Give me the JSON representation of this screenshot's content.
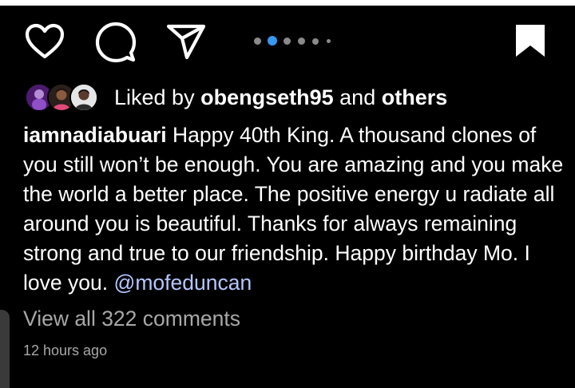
{
  "post": {
    "actions": {
      "like_icon": "heart-outline-icon",
      "comment_icon": "comment-bubble-icon",
      "share_icon": "paper-plane-icon",
      "save_icon": "bookmark-filled-icon"
    },
    "carousel": {
      "total_dots": 6,
      "active_index": 1,
      "active_color": "#3897f0",
      "inactive_color": "#8a8a8a"
    },
    "likes": {
      "prefix": "Liked by",
      "user": "obengseth95",
      "joiner": "and",
      "others": "others"
    },
    "caption": {
      "username": "iamnadiabuari",
      "text": "Happy 40th King. A thousand clones of you still won’t be enough. You are amazing and you make the world a better place. The positive energy u radiate all around you is beautiful. Thanks for always remaining strong and true to our friendship. Happy birthday Mo. I love you.",
      "mention": "@mofeduncan"
    },
    "comments_link": "View all 322 comments",
    "timestamp": "12 hours ago"
  },
  "colors": {
    "background": "#000000",
    "text": "#ffffff",
    "secondary_text": "#a8a8a8",
    "mention": "#b6c6ff"
  }
}
